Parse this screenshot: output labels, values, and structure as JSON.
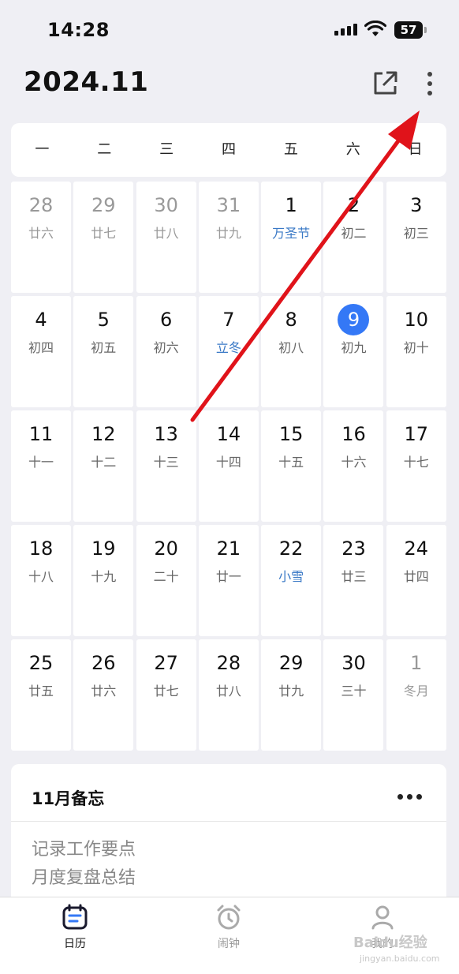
{
  "status": {
    "time": "14:28",
    "battery": "57"
  },
  "header": {
    "title": "2024.11"
  },
  "weekdays": [
    "一",
    "二",
    "三",
    "四",
    "五",
    "六",
    "日"
  ],
  "calendar": {
    "days": [
      {
        "num": "28",
        "lunar": "廿六",
        "dim": true
      },
      {
        "num": "29",
        "lunar": "廿七",
        "dim": true
      },
      {
        "num": "30",
        "lunar": "廿八",
        "dim": true
      },
      {
        "num": "31",
        "lunar": "廿九",
        "dim": true
      },
      {
        "num": "1",
        "lunar": "万圣节",
        "festival": true
      },
      {
        "num": "2",
        "lunar": "初二"
      },
      {
        "num": "3",
        "lunar": "初三"
      },
      {
        "num": "4",
        "lunar": "初四"
      },
      {
        "num": "5",
        "lunar": "初五"
      },
      {
        "num": "6",
        "lunar": "初六"
      },
      {
        "num": "7",
        "lunar": "立冬",
        "festival": true
      },
      {
        "num": "8",
        "lunar": "初八"
      },
      {
        "num": "9",
        "lunar": "初九",
        "today": true
      },
      {
        "num": "10",
        "lunar": "初十"
      },
      {
        "num": "11",
        "lunar": "十一"
      },
      {
        "num": "12",
        "lunar": "十二"
      },
      {
        "num": "13",
        "lunar": "十三"
      },
      {
        "num": "14",
        "lunar": "十四"
      },
      {
        "num": "15",
        "lunar": "十五"
      },
      {
        "num": "16",
        "lunar": "十六"
      },
      {
        "num": "17",
        "lunar": "十七"
      },
      {
        "num": "18",
        "lunar": "十八"
      },
      {
        "num": "19",
        "lunar": "十九"
      },
      {
        "num": "20",
        "lunar": "二十"
      },
      {
        "num": "21",
        "lunar": "廿一"
      },
      {
        "num": "22",
        "lunar": "小雪",
        "festival": true
      },
      {
        "num": "23",
        "lunar": "廿三"
      },
      {
        "num": "24",
        "lunar": "廿四"
      },
      {
        "num": "25",
        "lunar": "廿五"
      },
      {
        "num": "26",
        "lunar": "廿六"
      },
      {
        "num": "27",
        "lunar": "廿七"
      },
      {
        "num": "28",
        "lunar": "廿八"
      },
      {
        "num": "29",
        "lunar": "廿九"
      },
      {
        "num": "30",
        "lunar": "三十"
      },
      {
        "num": "1",
        "lunar": "冬月",
        "dim": true
      }
    ]
  },
  "memo": {
    "title": "11月备忘",
    "lines": [
      "记录工作要点",
      "月度复盘总结"
    ]
  },
  "tabs": [
    {
      "label": "日历",
      "icon": "calendar-icon",
      "active": true
    },
    {
      "label": "闹钟",
      "icon": "alarm-clock-icon"
    },
    {
      "label": "我的",
      "icon": "profile-icon"
    }
  ],
  "watermark": {
    "text": "Baidu经验",
    "sub": "jingyan.baidu.com"
  },
  "colors": {
    "accent": "#3478f6",
    "festival": "#3a79c6",
    "arrow": "#e0131a"
  }
}
